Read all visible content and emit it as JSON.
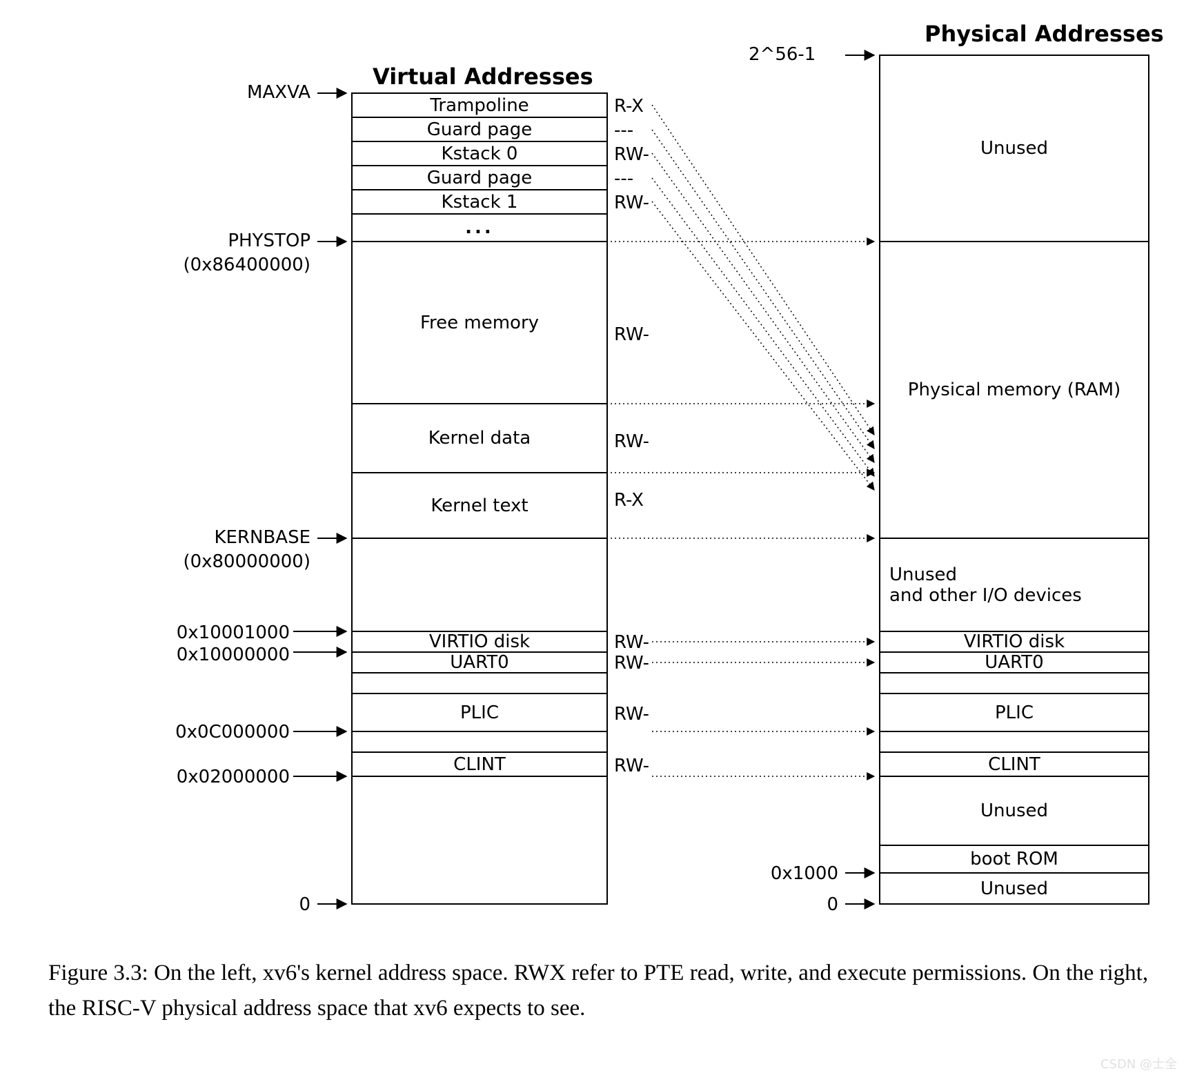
{
  "meta": {
    "watermark": "CSDN @士全"
  },
  "headers": {
    "virtual": "Virtual Addresses",
    "physical": "Physical Addresses"
  },
  "top_marker": "2^56-1",
  "virtual": {
    "labels": {
      "maxva": "MAXVA",
      "phystop1": "PHYSTOP",
      "phystop2": "(0x86400000)",
      "kernbase1": "KERNBASE",
      "kernbase2": "(0x80000000)",
      "virtio": "0x10001000",
      "uart": "0x10000000",
      "plic": "0x0C000000",
      "clint": "0x02000000",
      "zero": "0"
    },
    "regions": {
      "trampoline": {
        "name": "Trampoline",
        "perm": "R-X"
      },
      "guard0": {
        "name": "Guard page",
        "perm": "---"
      },
      "kstack0": {
        "name": "Kstack 0",
        "perm": "RW-"
      },
      "guard1": {
        "name": "Guard page",
        "perm": "---"
      },
      "kstack1": {
        "name": "Kstack 1",
        "perm": "RW-"
      },
      "dots": "...",
      "free": {
        "name": "Free memory",
        "perm": "RW-"
      },
      "kdata": {
        "name": "Kernel data",
        "perm": "RW-"
      },
      "ktext": {
        "name": "Kernel text",
        "perm": "R-X"
      },
      "virtio": {
        "name": "VIRTIO disk",
        "perm": "RW-"
      },
      "uart": {
        "name": "UART0",
        "perm": "RW-"
      },
      "plic": {
        "name": "PLIC",
        "perm": "RW-"
      },
      "clint": {
        "name": "CLINT",
        "perm": "RW-"
      }
    }
  },
  "physical": {
    "labels": {
      "bootrom_addr": "0x1000",
      "zero": "0"
    },
    "regions": {
      "unused_top": "Unused",
      "ram": "Physical memory (RAM)",
      "unused_io": "Unused\nand other I/O devices",
      "virtio": "VIRTIO disk",
      "uart": "UART0",
      "plic": "PLIC",
      "clint": "CLINT",
      "unused_mid": "Unused",
      "bootrom": "boot ROM",
      "unused_bot": "Unused"
    }
  },
  "caption": "Figure 3.3: On the left, xv6's kernel address space. RWX refer to PTE read, write, and execute permissions. On the right, the RISC-V physical address space that xv6 expects to see."
}
